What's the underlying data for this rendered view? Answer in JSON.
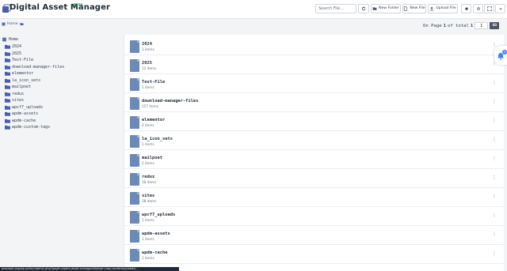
{
  "app": {
    "title": "Digital Asset Manager",
    "badge": "BETA"
  },
  "toolbar": {
    "search_placeholder": "Search File...",
    "new_folder": "New Folder",
    "new_file": "New File",
    "upload_file": "Upload File"
  },
  "breadcrumb": {
    "home": "Home"
  },
  "pager": {
    "prefix": "On Page",
    "current": "1",
    "middle": "of total",
    "total": "1",
    "input_value": "1",
    "go": "GO"
  },
  "tree": {
    "root": "Home",
    "items": [
      "2024",
      "2025",
      "Test-File",
      "download-manager-files",
      "elementor",
      "la_icon_sets",
      "mailpoet",
      "redux",
      "sites",
      "wpcf7_uploads",
      "wpdm-assets",
      "wpdm-cache",
      "wpdm-custom-tags"
    ]
  },
  "folders": [
    {
      "name": "2024",
      "count": "3 items"
    },
    {
      "name": "2025",
      "count": "12 items"
    },
    {
      "name": "Test-File",
      "count": "1 items"
    },
    {
      "name": "download-manager-files",
      "count": "157 items"
    },
    {
      "name": "elementor",
      "count": "4 items"
    },
    {
      "name": "la_icon_sets",
      "count": "1 items"
    },
    {
      "name": "mailpoet",
      "count": "2 items"
    },
    {
      "name": "redux",
      "count": "18 items"
    },
    {
      "name": "sites",
      "count": "38 items"
    },
    {
      "name": "wpcf7_uploads",
      "count": "1 items"
    },
    {
      "name": "wpdm-assets",
      "count": "1 items"
    },
    {
      "name": "wpdm-cache",
      "count": "2 items"
    }
  ],
  "notification": {
    "count": "6"
  },
  "status_url": "example.org/wp-admin/admin.php?page=wpdm-asset-manager&folder=/wp-content/uploads/...",
  "colors": {
    "accent": "#5b6fb0",
    "folder": "#4a5fa8",
    "thumb": "#6b8ab8",
    "go": "#4b5563"
  }
}
